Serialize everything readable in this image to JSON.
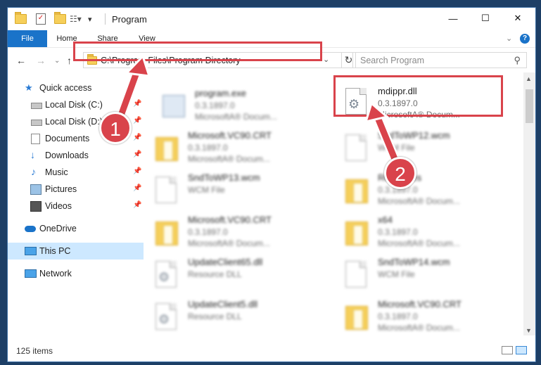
{
  "window": {
    "title": "Program",
    "help": "?"
  },
  "window_controls": {
    "minimize": "—",
    "maximize": "☐",
    "close": "✕"
  },
  "ribbon": {
    "tabs": [
      "File",
      "Home",
      "Share",
      "View"
    ]
  },
  "nav": {
    "back": "←",
    "forward": "→",
    "up": "↑",
    "recent": "⌄"
  },
  "address": {
    "path": "C:\\Program Files\\Program Directory",
    "refresh": "↻"
  },
  "search": {
    "placeholder": "Search Program",
    "icon": "search-icon"
  },
  "sidebar": {
    "items": [
      {
        "label": "Quick access",
        "icon": "star-icon"
      },
      {
        "label": "Local Disk (C:)",
        "icon": "disk-icon",
        "pinned": true
      },
      {
        "label": "Local Disk (D:)",
        "icon": "disk-icon",
        "pinned": true
      },
      {
        "label": "Documents",
        "icon": "documents-icon",
        "pinned": true
      },
      {
        "label": "Downloads",
        "icon": "download-icon",
        "pinned": true
      },
      {
        "label": "Music",
        "icon": "music-icon",
        "pinned": true
      },
      {
        "label": "Pictures",
        "icon": "pictures-icon",
        "pinned": true
      },
      {
        "label": "Videos",
        "icon": "videos-icon",
        "pinned": true
      },
      {
        "label": "OneDrive",
        "icon": "cloud-icon"
      },
      {
        "label": "This PC",
        "icon": "monitor-icon",
        "selected": true
      },
      {
        "label": "Network",
        "icon": "network-icon"
      }
    ]
  },
  "files": [
    {
      "name": "program.exe",
      "l2": "0.3.1897.0",
      "l3": "MicrosoftA® Docum...",
      "icon": "exe"
    },
    {
      "name": "mdippr.dll",
      "l2": "0.3.1897.0",
      "l3": "MicrosoftA® Docum...",
      "icon": "dll"
    },
    {
      "name": "Microsoft.VC90.CRT",
      "l2": "0.3.1897.0",
      "l3": "MicrosoftA® Docum...",
      "icon": "folder"
    },
    {
      "name": "SndToWP12.wcm",
      "l2": "WCM File",
      "l3": "",
      "icon": "doc"
    },
    {
      "name": "SndToWP13.wcm",
      "l2": "WCM File",
      "l3": "",
      "icon": "doc"
    },
    {
      "name": "Resources",
      "l2": "0.3.1897.0",
      "l3": "MicrosoftA® Docum...",
      "icon": "folder"
    },
    {
      "name": "Microsoft.VC90.CRT",
      "l2": "0.3.1897.0",
      "l3": "MicrosoftA® Docum...",
      "icon": "folder"
    },
    {
      "name": "x64",
      "l2": "0.3.1897.0",
      "l3": "MicrosoftA® Docum...",
      "icon": "folder"
    },
    {
      "name": "UpdateClient65.dll",
      "l2": "Resource DLL",
      "l3": "",
      "icon": "dll"
    },
    {
      "name": "SndToWP14.wcm",
      "l2": "WCM File",
      "l3": "",
      "icon": "doc"
    },
    {
      "name": "UpdateClient5.dll",
      "l2": "Resource DLL",
      "l3": "",
      "icon": "dll"
    },
    {
      "name": "Microsoft.VC90.CRT",
      "l2": "0.3.1897.0",
      "l3": "MicrosoftA® Docum...",
      "icon": "folder"
    }
  ],
  "status": {
    "items": "125 items"
  },
  "annotations": {
    "step1": "1",
    "step2": "2",
    "color": "#d9434b"
  }
}
